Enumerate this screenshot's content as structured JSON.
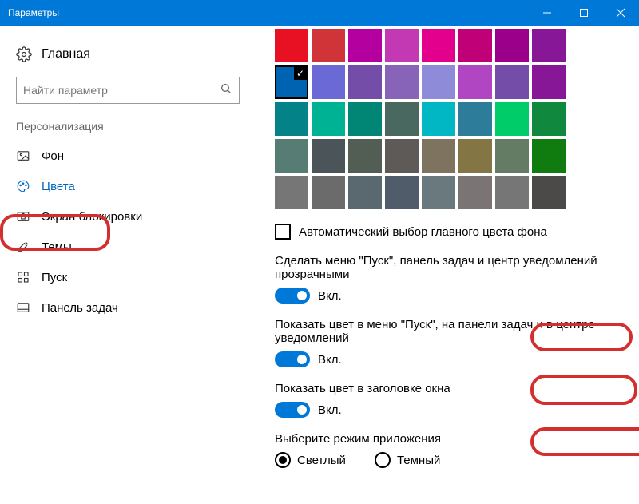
{
  "window": {
    "title": "Параметры"
  },
  "home_label": "Главная",
  "search_placeholder": "Найти параметр",
  "category": "Персонализация",
  "nav": [
    {
      "icon": "picture",
      "label": "Фон"
    },
    {
      "icon": "palette",
      "label": "Цвета",
      "active": true
    },
    {
      "icon": "lock",
      "label": "Экран блокировки"
    },
    {
      "icon": "brush",
      "label": "Темы"
    },
    {
      "icon": "grid",
      "label": "Пуск"
    },
    {
      "icon": "taskbar",
      "label": "Панель задач"
    }
  ],
  "palette": [
    [
      "#e81123",
      "#d13438",
      "#b4009e",
      "#c239b3",
      "#e3008c",
      "#bf0077",
      "#9a0089",
      "#881798"
    ],
    [
      "#0063b1",
      "#6b69d6",
      "#744da9",
      "#8764b8",
      "#8e8cd8",
      "#b146c2",
      "#744da9",
      "#881798"
    ],
    [
      "#038387",
      "#00b294",
      "#018574",
      "#486860",
      "#00b7c3",
      "#2d7d9a",
      "#00cc6a",
      "#10893e"
    ],
    [
      "#567c73",
      "#4a5459",
      "#525e54",
      "#5d5a58",
      "#7e735f",
      "#847545",
      "#647c64",
      "#107c10"
    ],
    [
      "#767676",
      "#6b6b6b",
      "#5a6870",
      "#515c6b",
      "#69797e",
      "#7a7574",
      "#767676",
      "#4c4a48"
    ]
  ],
  "selected_swatch": [
    1,
    0
  ],
  "auto_color_label": "Автоматический выбор главного цвета фона",
  "settings": [
    {
      "label": "Сделать меню \"Пуск\", панель задач и центр уведомлений прозрачными",
      "state": "Вкл."
    },
    {
      "label": "Показать цвет в меню \"Пуск\", на панели задач и в центре уведомлений",
      "state": "Вкл."
    },
    {
      "label": "Показать цвет в заголовке окна",
      "state": "Вкл."
    }
  ],
  "mode": {
    "label": "Выберите режим приложения",
    "options": [
      "Светлый",
      "Темный"
    ],
    "selected": 0
  }
}
